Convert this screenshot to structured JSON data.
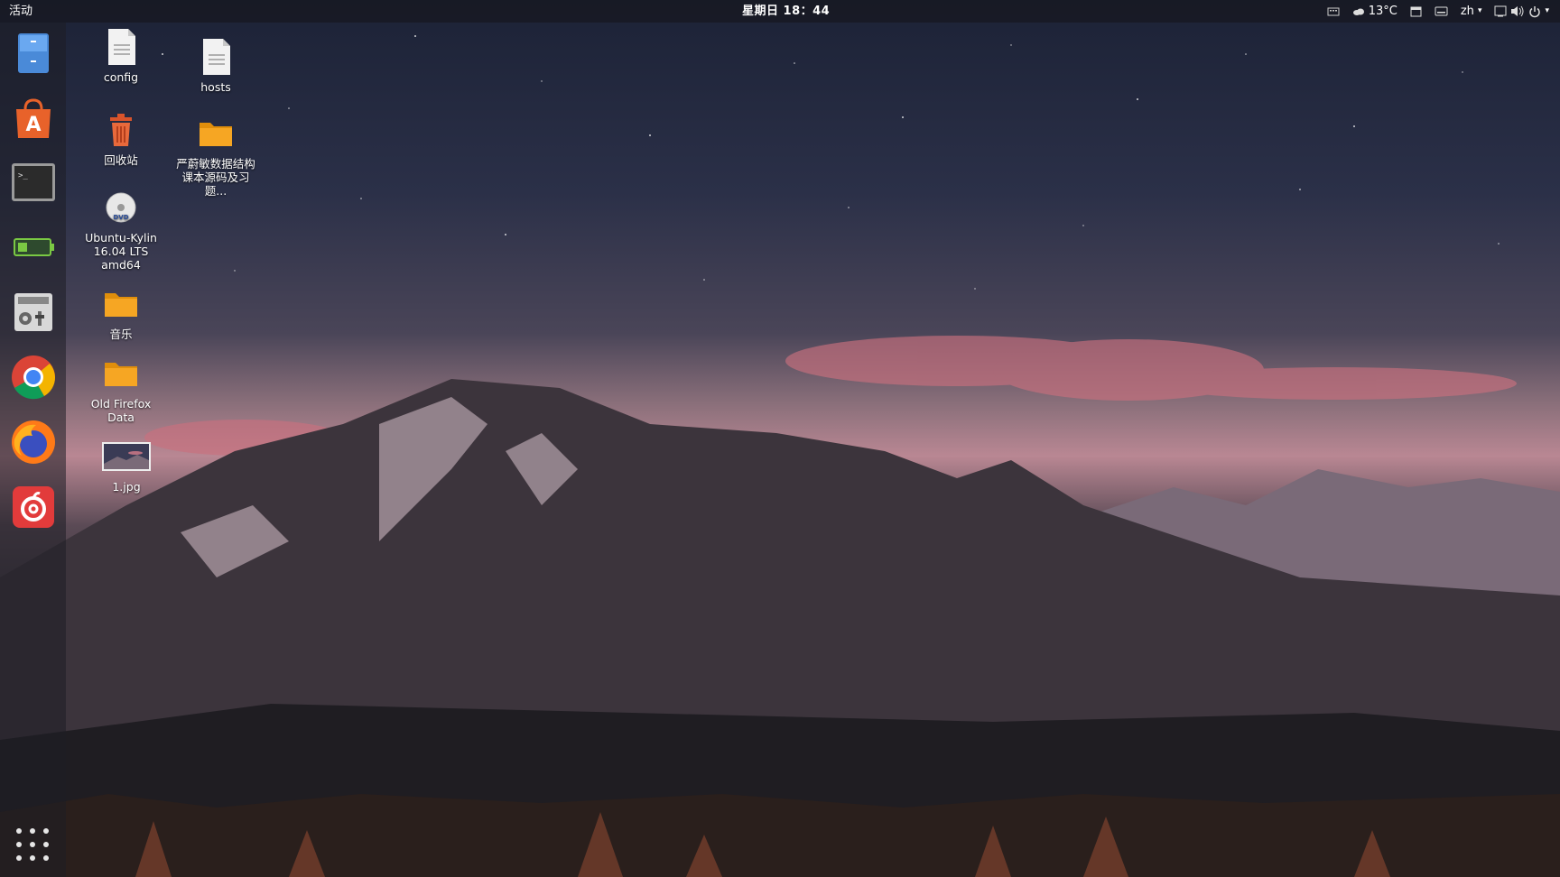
{
  "topbar": {
    "activities": "活动",
    "clock": "星期日 18：44",
    "weather": "13°C",
    "language": "zh"
  },
  "dock": {
    "items": [
      {
        "name": "files",
        "icon": "file-manager-icon"
      },
      {
        "name": "software-center",
        "icon": "ubuntu-software-icon"
      },
      {
        "name": "terminal",
        "icon": "terminal-icon"
      },
      {
        "name": "system-monitor",
        "icon": "system-monitor-icon"
      },
      {
        "name": "settings",
        "icon": "system-settings-icon"
      },
      {
        "name": "chrome",
        "icon": "chrome-icon"
      },
      {
        "name": "firefox",
        "icon": "firefox-icon"
      },
      {
        "name": "netease-music",
        "icon": "netease-music-icon"
      }
    ],
    "show_apps": "apps-grid-icon"
  },
  "desktop": {
    "icons": [
      {
        "label": "config",
        "icon": "text-file-icon"
      },
      {
        "label": "hosts",
        "icon": "text-file-icon"
      },
      {
        "label": "回收站",
        "icon": "trash-icon"
      },
      {
        "label": "严蔚敏数据结构课本源码及习题...",
        "icon": "folder-icon"
      },
      {
        "label": "Ubuntu-Kylin 16.04 LTS amd64",
        "icon": "dvd-icon"
      },
      {
        "label": "音乐",
        "icon": "folder-icon"
      },
      {
        "label": "Old Firefox Data",
        "icon": "folder-icon"
      },
      {
        "label": "1.jpg",
        "icon": "image-thumbnail-icon"
      }
    ]
  },
  "colors": {
    "folder": "#f6a623",
    "dock_bg": "#1e1e24",
    "topbar_bg": "#141418"
  }
}
